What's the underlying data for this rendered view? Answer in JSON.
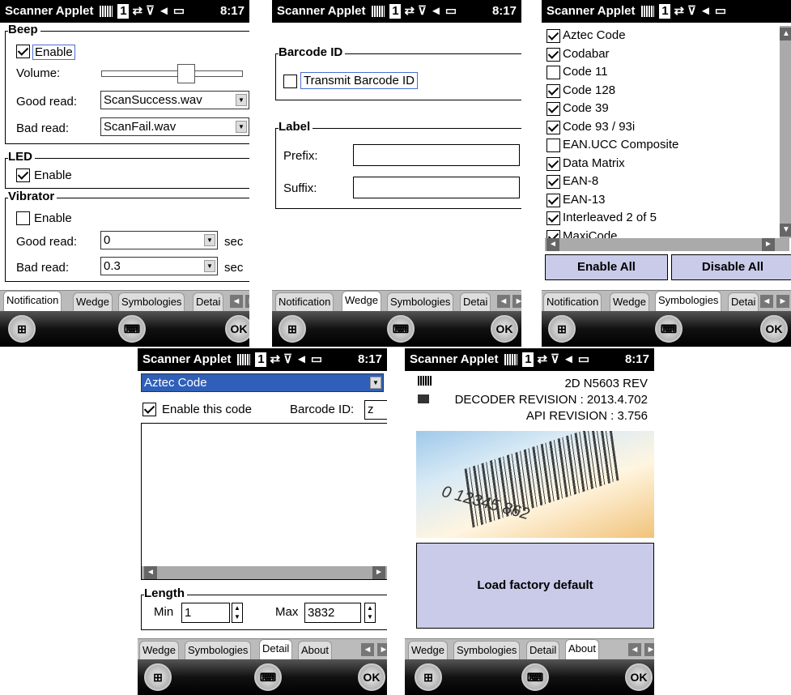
{
  "title_bar": {
    "app": "Scanner Applet",
    "badge": "1",
    "time": "8:17"
  },
  "tabs": {
    "notification": "Notification",
    "wedge": "Wedge",
    "symbologies": "Symbologies",
    "detail": "Detail",
    "detail_trunc": "Detai",
    "about": "About"
  },
  "softkeys": {
    "ok": "OK"
  },
  "notification": {
    "beep": {
      "title": "Beep",
      "enable": "Enable",
      "enabled": true,
      "volume_label": "Volume:",
      "volume_level": 0.6,
      "good_label": "Good read:",
      "good_value": "ScanSuccess.wav",
      "bad_label": "Bad read:",
      "bad_value": "ScanFail.wav"
    },
    "led": {
      "title": "LED",
      "enable": "Enable",
      "enabled": true
    },
    "vibrator": {
      "title": "Vibrator",
      "enable": "Enable",
      "enabled": false,
      "good_label": "Good read:",
      "good_value": "0",
      "bad_label": "Bad read:",
      "bad_value": "0.3",
      "unit": "sec"
    }
  },
  "wedge": {
    "barcode_title": "Barcode ID",
    "transmit": "Transmit Barcode ID",
    "transmit_checked": false,
    "label_title": "Label",
    "prefix_label": "Prefix:",
    "prefix_value": "",
    "suffix_label": "Suffix:",
    "suffix_value": ""
  },
  "symbologies": {
    "items": [
      {
        "label": "Aztec Code",
        "checked": true
      },
      {
        "label": "Codabar",
        "checked": true
      },
      {
        "label": "Code 11",
        "checked": false
      },
      {
        "label": "Code 128",
        "checked": true
      },
      {
        "label": "Code 39",
        "checked": true
      },
      {
        "label": "Code 93 / 93i",
        "checked": true
      },
      {
        "label": "EAN.UCC Composite",
        "checked": false
      },
      {
        "label": "Data Matrix",
        "checked": true
      },
      {
        "label": "EAN-8",
        "checked": true
      },
      {
        "label": "EAN-13",
        "checked": true
      },
      {
        "label": "Interleaved 2 of 5",
        "checked": true
      },
      {
        "label": "MaxiCode",
        "checked": true
      }
    ],
    "enable_all": "Enable All",
    "disable_all": "Disable All"
  },
  "detail": {
    "selected_code": "Aztec Code",
    "enable_code": "Enable this code",
    "enable_checked": true,
    "barcode_id_label": "Barcode ID:",
    "barcode_id_value": "z",
    "length_title": "Length",
    "min_label": "Min",
    "min_value": "1",
    "max_label": "Max",
    "max_value": "3832"
  },
  "about": {
    "engine": "2D N5603 REV",
    "decoder": "DECODER REVISION : 2013.4.702",
    "api": "API REVISION : 3.756",
    "image_digits": "0 12345 862",
    "factory_default": "Load factory default"
  }
}
